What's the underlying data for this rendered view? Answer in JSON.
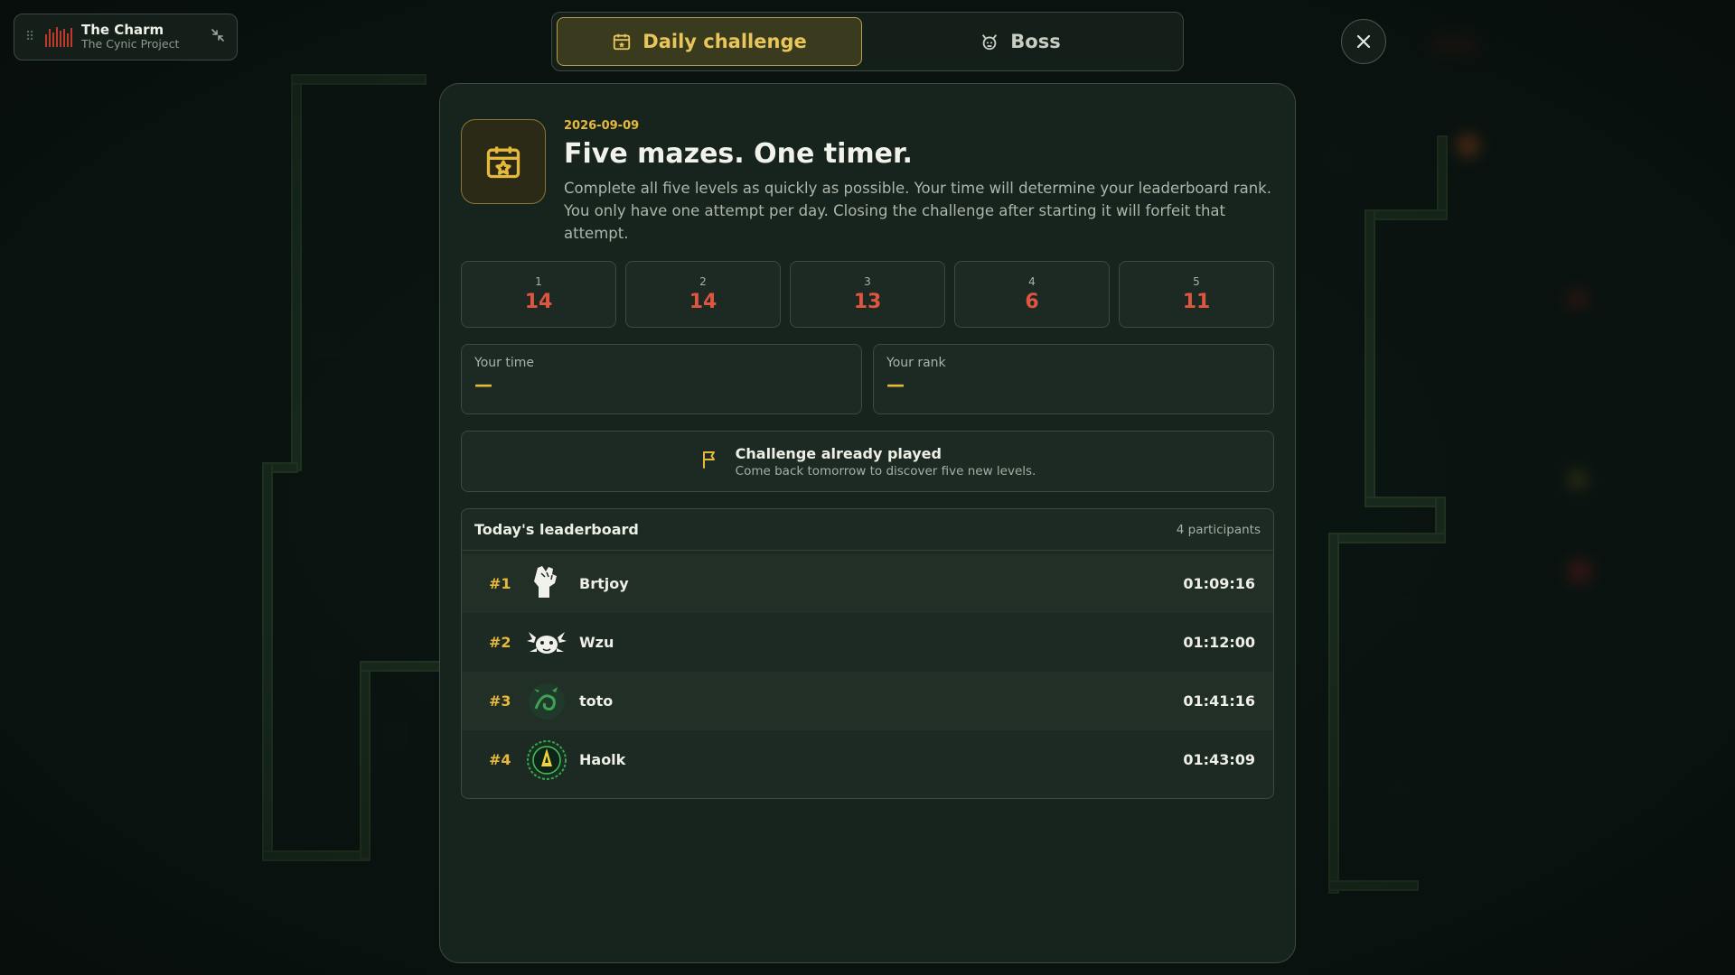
{
  "music": {
    "title": "The Charm",
    "artist": "The Cynic Project"
  },
  "tabs": [
    {
      "label": "Daily challenge",
      "icon": "calendar-star-icon",
      "active": true
    },
    {
      "label": "Boss",
      "icon": "demon-icon",
      "active": false
    }
  ],
  "challenge": {
    "date": "2026-09-09",
    "title": "Five mazes. One timer.",
    "desc_line1": "Complete all five levels as quickly as possible. Your time will determine your leaderboard rank.",
    "desc_line2": "You only have one attempt per day. Closing the challenge after starting it will forfeit that attempt."
  },
  "levels": [
    {
      "num": "1",
      "value": "14"
    },
    {
      "num": "2",
      "value": "14"
    },
    {
      "num": "3",
      "value": "13"
    },
    {
      "num": "4",
      "value": "6"
    },
    {
      "num": "5",
      "value": "11"
    }
  ],
  "stats": {
    "time_label": "Your time",
    "time_value": "—",
    "rank_label": "Your rank",
    "rank_value": "—"
  },
  "notice": {
    "title": "Challenge already played",
    "subtitle": "Come back tomorrow to discover five new levels."
  },
  "leaderboard": {
    "title": "Today's leaderboard",
    "count": "4 participants",
    "rows": [
      {
        "rank": "#1",
        "name": "Brtjoy",
        "time": "01:09:16",
        "avatar": "fist-icon"
      },
      {
        "rank": "#2",
        "name": "Wzu",
        "time": "01:12:00",
        "avatar": "axolotl-icon"
      },
      {
        "rank": "#3",
        "name": "toto",
        "time": "01:41:16",
        "avatar": "dragon-icon"
      },
      {
        "rank": "#4",
        "name": "Haolk",
        "time": "01:43:09",
        "avatar": "flame-badge-icon"
      }
    ]
  },
  "colors": {
    "accent": "#e6b93c",
    "level_value": "#e0553f",
    "panel": "#17231d"
  }
}
